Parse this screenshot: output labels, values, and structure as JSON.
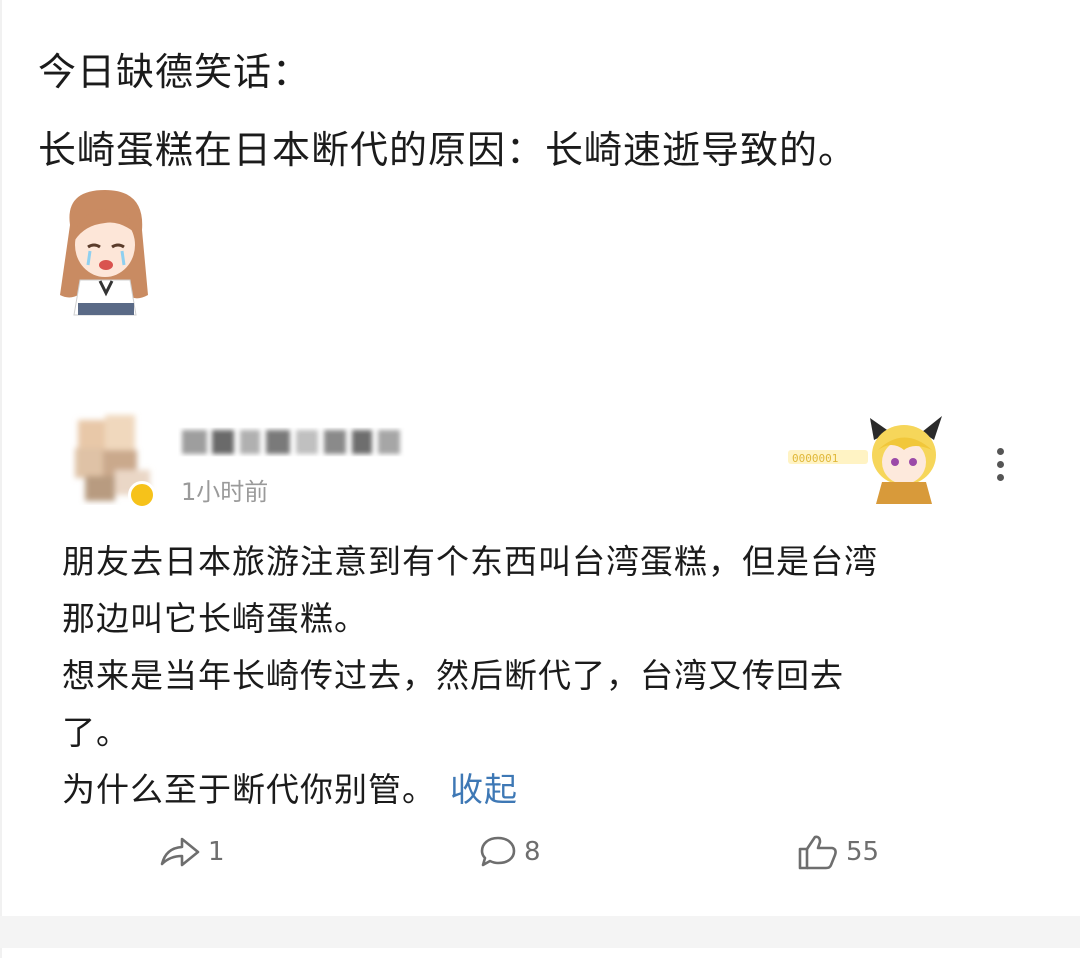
{
  "post": {
    "title": "今日缺德笑话：",
    "body": "长崎蛋糕在日本断代的原因：长崎速逝导致的。",
    "sticker_icon": "crying-girl-sticker"
  },
  "comment": {
    "time": "1小时前",
    "lines": [
      "朋友去日本旅游注意到有个东西叫台湾蛋糕，但是台湾",
      "那边叫它长崎蛋糕。",
      "想来是当年长崎传过去，然后断代了，台湾又传回去",
      "了。"
    ],
    "last_line": "为什么至于断代你别管。",
    "collapse_label": "收起",
    "medal_icon": "anime-cat-ear-medal",
    "medal_text": "0000001"
  },
  "actions": {
    "share_count": "1",
    "reply_count": "8",
    "like_count": "55"
  },
  "colors": {
    "link": "#3e78b5",
    "meta": "#9a9a9a",
    "badge": "#f6c21a"
  }
}
